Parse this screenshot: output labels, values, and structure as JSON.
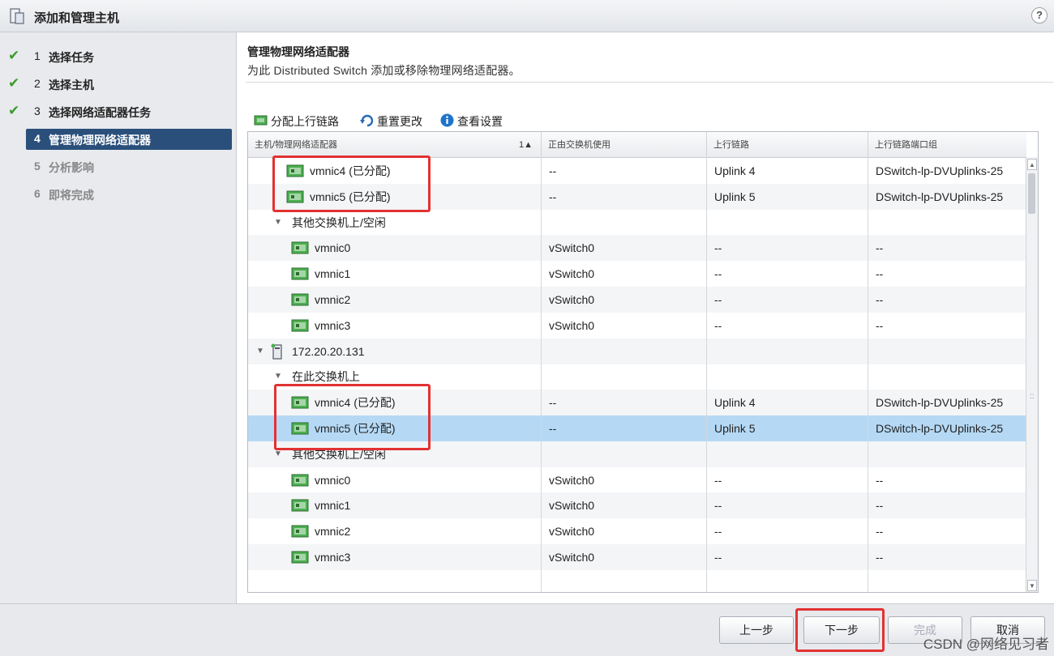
{
  "window": {
    "title": "添加和管理主机",
    "help": "?"
  },
  "steps": [
    {
      "num": "1",
      "label": "选择任务",
      "state": "done"
    },
    {
      "num": "2",
      "label": "选择主机",
      "state": "done"
    },
    {
      "num": "3",
      "label": "选择网络适配器任务",
      "state": "done"
    },
    {
      "num": "4",
      "label": "管理物理网络适配器",
      "state": "current"
    },
    {
      "num": "5",
      "label": "分析影响",
      "state": "future"
    },
    {
      "num": "6",
      "label": "即将完成",
      "state": "future"
    }
  ],
  "content": {
    "title": "管理物理网络适配器",
    "subtitle": "为此 Distributed Switch 添加或移除物理网络适配器。"
  },
  "toolbar": {
    "assign_uplink": "分配上行链路",
    "reset_changes": "重置更改",
    "view_settings": "查看设置"
  },
  "grid": {
    "columns": [
      "主机/物理网络适配器",
      "正由交换机使用",
      "上行链路",
      "上行链路端口组"
    ],
    "sort_indicator": "1▲",
    "rows": [
      {
        "type": "nic",
        "name": "vmnic4 (已分配)",
        "switch": "--",
        "uplink": "Uplink 4",
        "portgroup": "DSwitch-lp-DVUplinks-25"
      },
      {
        "type": "nic",
        "name": "vmnic5 (已分配)",
        "switch": "--",
        "uplink": "Uplink 5",
        "portgroup": "DSwitch-lp-DVUplinks-25"
      },
      {
        "type": "group",
        "name": "其他交换机上/空闲"
      },
      {
        "type": "nic",
        "name": "vmnic0",
        "switch": "vSwitch0",
        "uplink": "--",
        "portgroup": "--"
      },
      {
        "type": "nic",
        "name": "vmnic1",
        "switch": "vSwitch0",
        "uplink": "--",
        "portgroup": "--"
      },
      {
        "type": "nic",
        "name": "vmnic2",
        "switch": "vSwitch0",
        "uplink": "--",
        "portgroup": "--"
      },
      {
        "type": "nic",
        "name": "vmnic3",
        "switch": "vSwitch0",
        "uplink": "--",
        "portgroup": "--"
      },
      {
        "type": "host",
        "name": "172.20.20.131"
      },
      {
        "type": "group",
        "name": "在此交换机上"
      },
      {
        "type": "nic",
        "name": "vmnic4 (已分配)",
        "switch": "--",
        "uplink": "Uplink 4",
        "portgroup": "DSwitch-lp-DVUplinks-25"
      },
      {
        "type": "nic",
        "name": "vmnic5 (已分配)",
        "switch": "--",
        "uplink": "Uplink 5",
        "portgroup": "DSwitch-lp-DVUplinks-25",
        "selected": true
      },
      {
        "type": "group",
        "name": "其他交换机上/空闲"
      },
      {
        "type": "nic",
        "name": "vmnic0",
        "switch": "vSwitch0",
        "uplink": "--",
        "portgroup": "--"
      },
      {
        "type": "nic",
        "name": "vmnic1",
        "switch": "vSwitch0",
        "uplink": "--",
        "portgroup": "--"
      },
      {
        "type": "nic",
        "name": "vmnic2",
        "switch": "vSwitch0",
        "uplink": "--",
        "portgroup": "--"
      },
      {
        "type": "nic",
        "name": "vmnic3",
        "switch": "vSwitch0",
        "uplink": "--",
        "portgroup": "--"
      }
    ]
  },
  "footer": {
    "back": "上一步",
    "next": "下一步",
    "finish": "完成",
    "cancel": "取消"
  },
  "watermark": "CSDN @网络见习者",
  "colors": {
    "annotation_red": "#e23232",
    "selected_row": "#b5d9f5",
    "current_step": "#2a4f7a",
    "check_green": "#3d9a2e"
  }
}
